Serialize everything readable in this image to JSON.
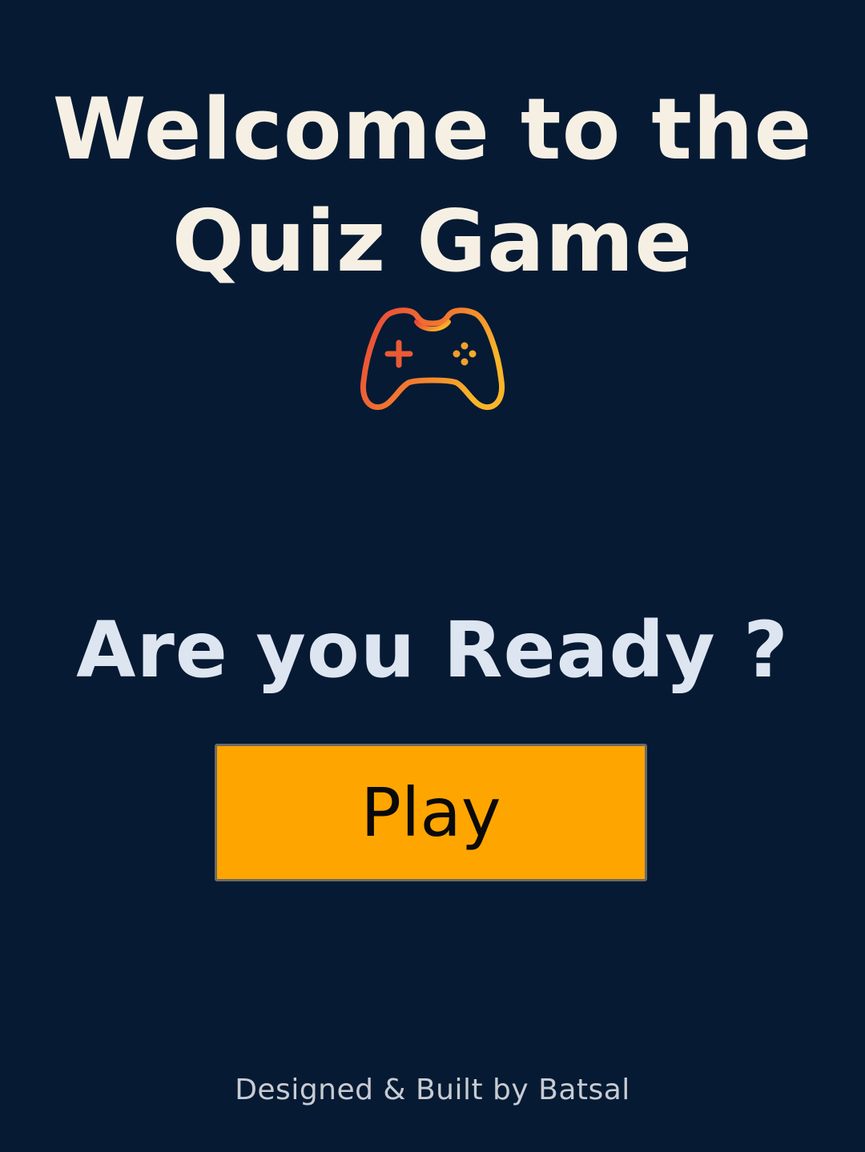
{
  "title": {
    "line1": "Welcome to the",
    "line2": "Quiz Game"
  },
  "icon": {
    "name": "gamepad-icon",
    "gradient_start": "#e8453a",
    "gradient_end": "#f8b529"
  },
  "prompt": "Are you Ready ?",
  "play_button": {
    "label": "Play",
    "color": "#ffa500"
  },
  "footer": "Designed & Built by Batsal",
  "colors": {
    "background": "#061a33",
    "title": "#f6f0e4",
    "prompt": "#dde5f1"
  }
}
